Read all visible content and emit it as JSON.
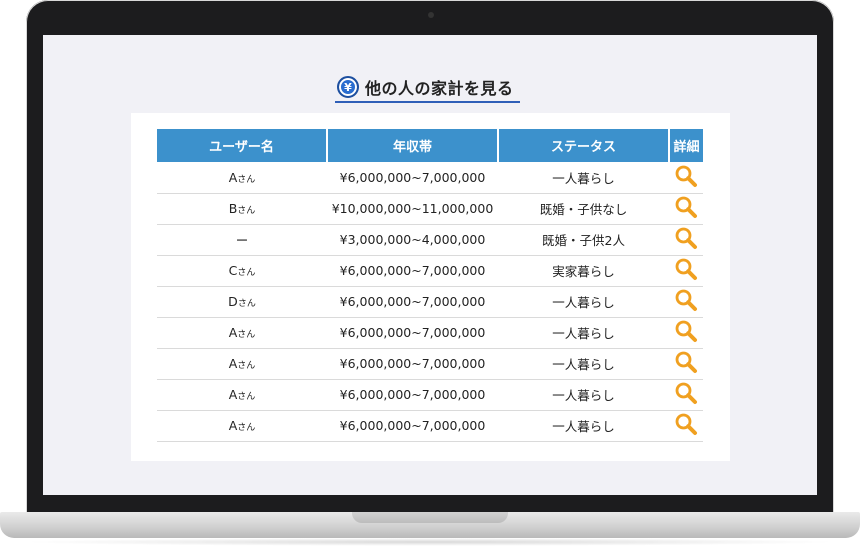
{
  "page": {
    "title": "他の人の家計を見る",
    "title_icon": "yen-coin-icon",
    "title_icon_glyph": "¥"
  },
  "table": {
    "headers": [
      "ユーザー名",
      "年収帯",
      "ステータス",
      "詳細"
    ],
    "rows": [
      {
        "name": "A",
        "suffix": "さん",
        "income": "¥6,000,000~7,000,000",
        "status": "一人暮らし"
      },
      {
        "name": "B",
        "suffix": "さん",
        "income": "¥10,000,000~11,000,000",
        "status": "既婚・子供なし"
      },
      {
        "name": "ー",
        "suffix": "",
        "income": "¥3,000,000~4,000,000",
        "status": "既婚・子供2人"
      },
      {
        "name": "C",
        "suffix": "さん",
        "income": "¥6,000,000~7,000,000",
        "status": "実家暮らし"
      },
      {
        "name": "D",
        "suffix": "さん",
        "income": "¥6,000,000~7,000,000",
        "status": "一人暮らし"
      },
      {
        "name": "A",
        "suffix": "さん",
        "income": "¥6,000,000~7,000,000",
        "status": "一人暮らし"
      },
      {
        "name": "A",
        "suffix": "さん",
        "income": "¥6,000,000~7,000,000",
        "status": "一人暮らし"
      },
      {
        "name": "A",
        "suffix": "さん",
        "income": "¥6,000,000~7,000,000",
        "status": "一人暮らし"
      },
      {
        "name": "A",
        "suffix": "さん",
        "income": "¥6,000,000~7,000,000",
        "status": "一人暮らし"
      }
    ],
    "detail_icon": "magnifier-icon"
  },
  "colors": {
    "header_bg": "#3c91cc",
    "title_underline": "#2f5fb8",
    "magnifier": "#f0a020",
    "screen_bg": "#f1f1f6"
  }
}
